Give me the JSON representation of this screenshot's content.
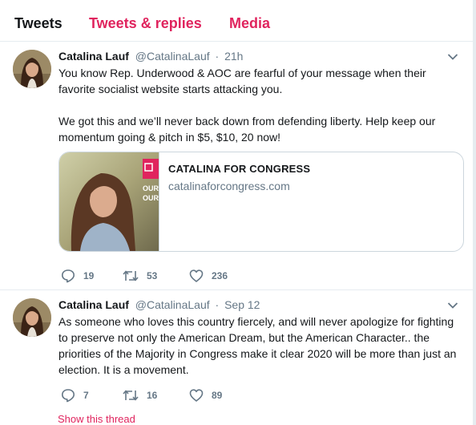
{
  "tabs": {
    "tweets": "Tweets",
    "replies": "Tweets & replies",
    "media": "Media"
  },
  "tweets": [
    {
      "name": "Catalina Lauf",
      "handle": "@CatalinaLauf",
      "separator": "·",
      "time": "21h",
      "paragraphs": [
        "You know Rep. Underwood & AOC are fearful of your message when their favorite socialist website starts attacking you.",
        "We got this and we’ll never back down from defending liberty. Help keep our momentum going & pitch in $5, $10, 20 now!"
      ],
      "card": {
        "title": "CATALINA FOR CONGRESS",
        "url": "catalinaforcongress.com",
        "image_text": "OUR OUR"
      },
      "replies": "19",
      "retweets": "53",
      "likes": "236"
    },
    {
      "name": "Catalina Lauf",
      "handle": "@CatalinaLauf",
      "separator": "·",
      "time": "Sep 12",
      "paragraphs": [
        "As someone who loves this country fiercely, and will never apologize for fighting to preserve not only the American Dream, but the American Character.. the priorities of the Majority in Congress make it clear 2020 will be more than just an election. It is a movement."
      ],
      "replies": "7",
      "retweets": "16",
      "likes": "89",
      "show_thread": "Show this thread"
    }
  ],
  "colors": {
    "accent": "#e0245e",
    "muted": "#657786",
    "text": "#14171a",
    "border": "#e6ecf0"
  },
  "icons": [
    "chevron-down-icon",
    "reply-icon",
    "retweet-icon",
    "like-icon"
  ]
}
